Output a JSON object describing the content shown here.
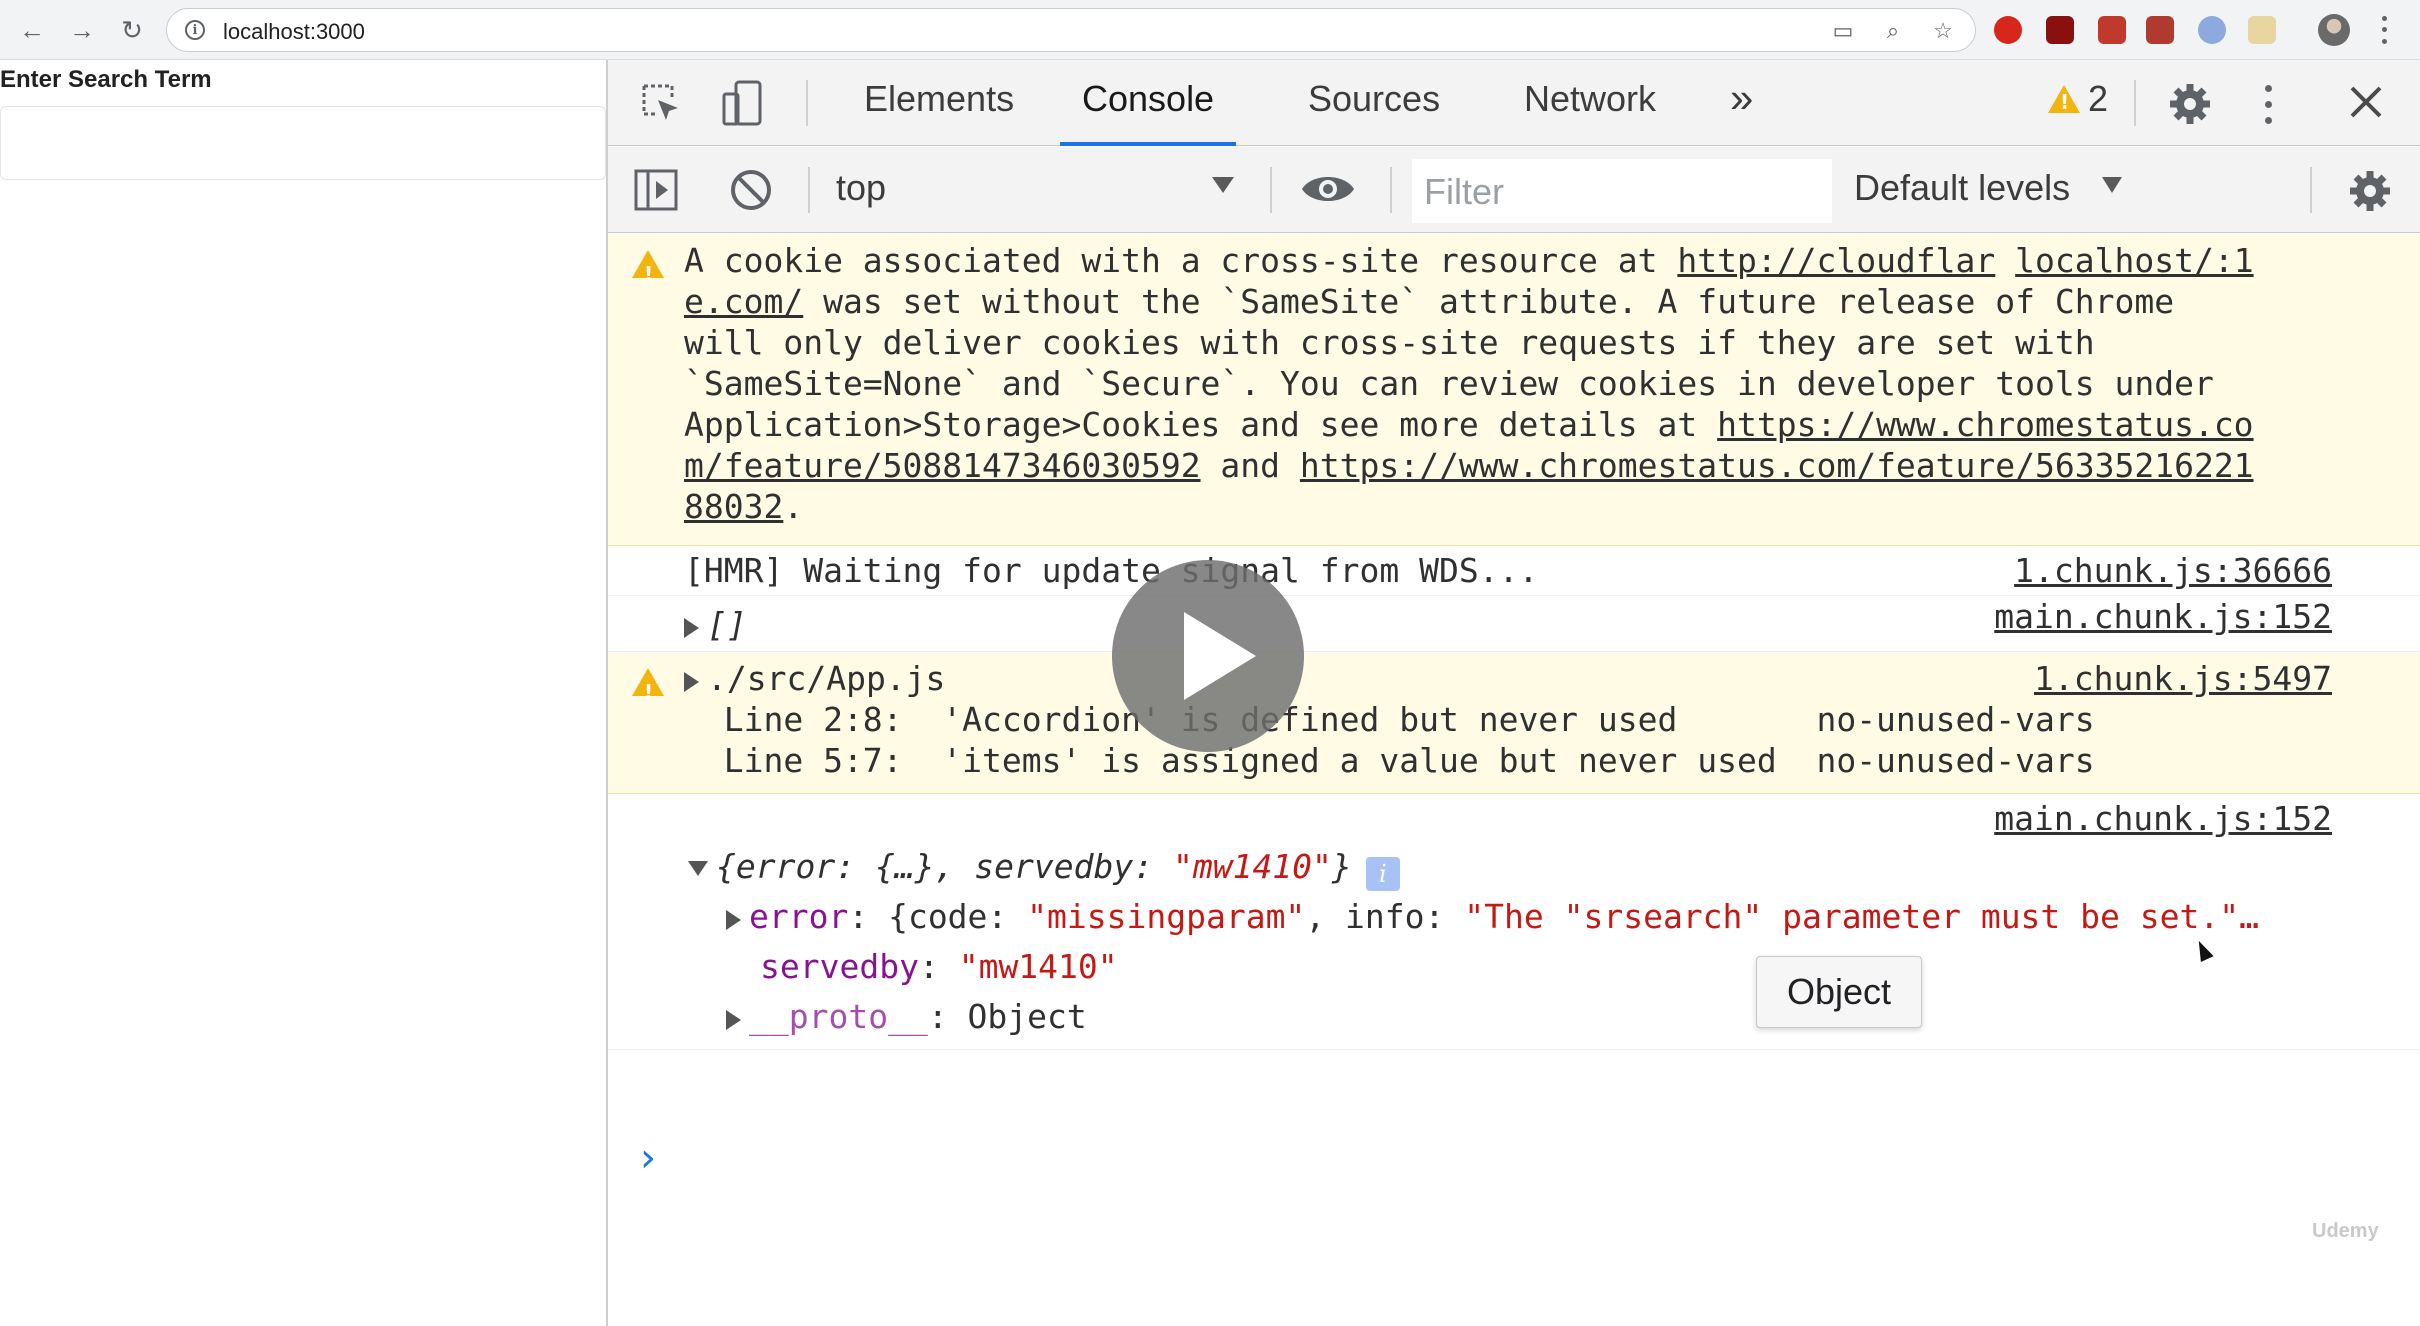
{
  "browser": {
    "url": "localhost:3000",
    "icons": [
      "back-arrow-icon",
      "forward-arrow-icon",
      "reload-icon",
      "info-icon",
      "cast-icon",
      "zoom-icon",
      "bookmark-star-icon"
    ]
  },
  "page": {
    "label": "Enter Search Term",
    "search_value": ""
  },
  "devtools": {
    "tabs": [
      "Elements",
      "Console",
      "Sources",
      "Network"
    ],
    "active_tab": "Console",
    "more_tabs": "»",
    "warning_count": "2",
    "context": "top",
    "filter_placeholder": "Filter",
    "levels": "Default levels"
  },
  "console": {
    "cookie_warning": {
      "line1_pre": "A cookie associated with a cross-site resource at ",
      "line1_link": "http://cloudflar",
      "line1_right_link": "localhost/:1",
      "line2_link": "e.com/",
      "line2_rest": " was set without the `SameSite` attribute. A future release of Chrome",
      "line3": "will only deliver cookies with cross-site requests if they are set with",
      "line4": "`SameSite=None` and `Secure`. You can review cookies in developer tools under",
      "line5_pre": "Application>Storage>Cookies and see more details at ",
      "line5_link": "https://www.chromestatus.co",
      "line6_link_a": "m/feature/5088147346030592",
      "line6_mid": " and ",
      "line6_link_b": "https://www.chromestatus.com/feature/56335216221",
      "line7_link": "88032",
      "line7_end": "."
    },
    "hmr": {
      "text": "[HMR] Waiting for update signal from WDS...",
      "source": "1.chunk.js:36666"
    },
    "empty_array": {
      "text": "[]",
      "source": "main.chunk.js:152"
    },
    "eslint_warning": {
      "file": "./src/App.js",
      "source": "1.chunk.js:5497",
      "line_a": "  Line 2:8:  'Accordion' is defined but never used       no-unused-vars",
      "line_b": "  Line 5:7:  'items' is assigned a value but never used  no-unused-vars"
    },
    "object_log": {
      "source": "main.chunk.js:152",
      "preview_a": "{error: {…}, servedby: ",
      "preview_val": "\"mw1410\"",
      "preview_b": "}",
      "error_key": "error",
      "error_pre": ": {code: ",
      "error_code": "\"missingparam\"",
      "error_mid": ", info: ",
      "error_info": "\"The \"srsearch\" parameter must be set.\"…",
      "servedby_key": "servedby",
      "servedby_val": "\"mw1410\"",
      "proto_key": "__proto__",
      "proto_val": ": Object"
    },
    "prompt": "›"
  },
  "tooltip": "Object",
  "watermark": "Udemy",
  "colors": {
    "accent": "#1a73e8",
    "warning_bg": "#fffbe5",
    "warning_icon": "#f2b50f",
    "string": "#c41a16",
    "key": "#881391"
  }
}
